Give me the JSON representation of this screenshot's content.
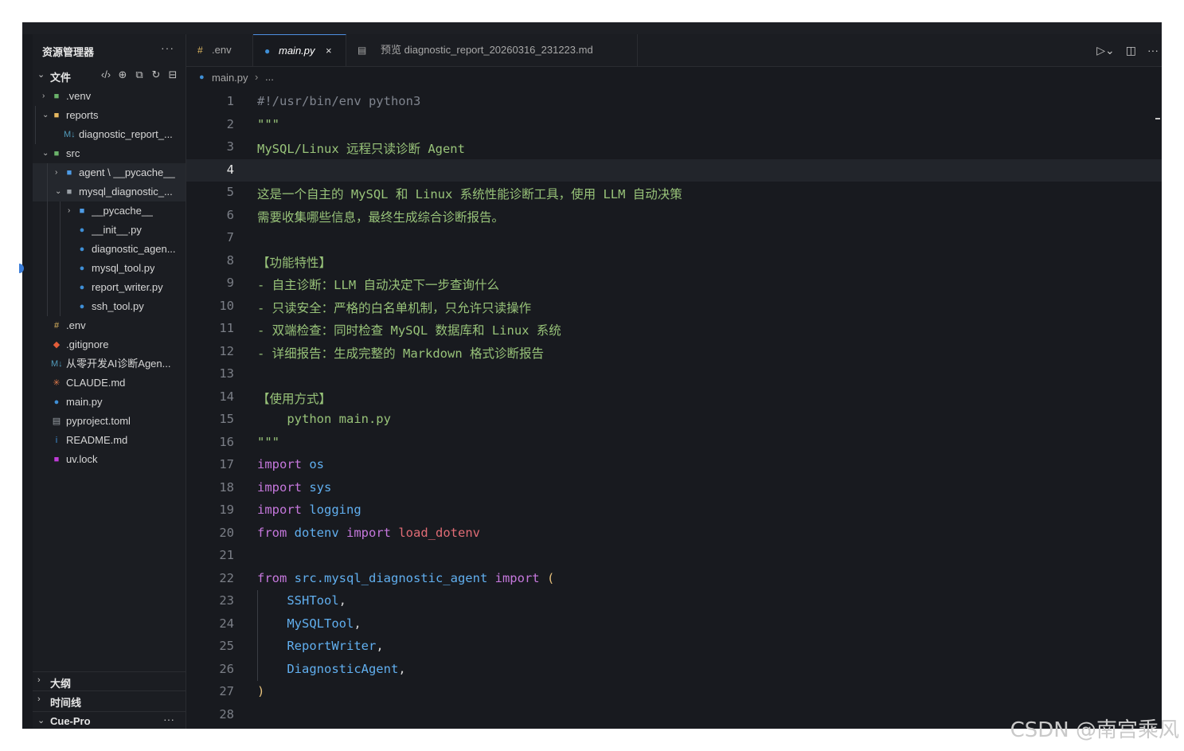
{
  "sidebar": {
    "title": "资源管理器",
    "more": "···",
    "section_label": "文件",
    "actions": [
      {
        "name": "code-icon",
        "glyph": "‹/›"
      },
      {
        "name": "new-file-icon",
        "glyph": "⊕"
      },
      {
        "name": "new-folder-icon",
        "glyph": "⧉"
      },
      {
        "name": "refresh-icon",
        "glyph": "↻"
      },
      {
        "name": "collapse-all-icon",
        "glyph": "⊟"
      }
    ],
    "tree": [
      {
        "name": ".venv",
        "depth": 0,
        "chev": "›",
        "icon": "folder-venv-icon",
        "glyph": "■",
        "color": "#6bb36b"
      },
      {
        "name": "reports",
        "depth": 0,
        "chev": "⌄",
        "icon": "folder-open-icon",
        "glyph": "■",
        "color": "#e7b860"
      },
      {
        "name": "diagnostic_report_...",
        "depth": 1,
        "chev": "",
        "icon": "markdown-icon",
        "glyph": "M↓",
        "color": "#519aba"
      },
      {
        "name": "src",
        "depth": 0,
        "chev": "⌄",
        "icon": "folder-src-icon",
        "glyph": "■",
        "color": "#6bb36b"
      },
      {
        "name": "agent \\ __pycache__",
        "depth": 1,
        "chev": "›",
        "icon": "folder-icon",
        "glyph": "■",
        "color": "#4e9ce6",
        "selected": true
      },
      {
        "name": "mysql_diagnostic_...",
        "depth": 1,
        "chev": "⌄",
        "icon": "folder-open-icon",
        "glyph": "■",
        "color": "#9aa0a6",
        "selected": true
      },
      {
        "name": "__pycache__",
        "depth": 2,
        "chev": "›",
        "icon": "folder-icon",
        "glyph": "■",
        "color": "#4e9ce6"
      },
      {
        "name": "__init__.py",
        "depth": 2,
        "chev": "",
        "icon": "python-icon",
        "glyph": "●",
        "color": "#3f8fd6"
      },
      {
        "name": "diagnostic_agen...",
        "depth": 2,
        "chev": "",
        "icon": "python-icon",
        "glyph": "●",
        "color": "#3f8fd6"
      },
      {
        "name": "mysql_tool.py",
        "depth": 2,
        "chev": "",
        "icon": "python-icon",
        "glyph": "●",
        "color": "#3f8fd6"
      },
      {
        "name": "report_writer.py",
        "depth": 2,
        "chev": "",
        "icon": "python-icon",
        "glyph": "●",
        "color": "#3f8fd6"
      },
      {
        "name": "ssh_tool.py",
        "depth": 2,
        "chev": "",
        "icon": "python-icon",
        "glyph": "●",
        "color": "#3f8fd6"
      },
      {
        "name": ".env",
        "depth": 0,
        "chev": "",
        "icon": "env-icon",
        "glyph": "#",
        "color": "#e0b860"
      },
      {
        "name": ".gitignore",
        "depth": 0,
        "chev": "",
        "icon": "git-icon",
        "glyph": "◆",
        "color": "#e35d3a"
      },
      {
        "name": "从零开发AI诊断Agen...",
        "depth": 0,
        "chev": "",
        "icon": "markdown-icon",
        "glyph": "M↓",
        "color": "#519aba"
      },
      {
        "name": "CLAUDE.md",
        "depth": 0,
        "chev": "",
        "icon": "claude-icon",
        "glyph": "✳",
        "color": "#e07a4b"
      },
      {
        "name": "main.py",
        "depth": 0,
        "chev": "",
        "icon": "python-icon",
        "glyph": "●",
        "color": "#3f8fd6"
      },
      {
        "name": "pyproject.toml",
        "depth": 0,
        "chev": "",
        "icon": "toml-icon",
        "glyph": "▤",
        "color": "#9aa0a6"
      },
      {
        "name": "README.md",
        "depth": 0,
        "chev": "",
        "icon": "info-icon",
        "glyph": "i",
        "color": "#3f8fd6"
      },
      {
        "name": "uv.lock",
        "depth": 0,
        "chev": "",
        "icon": "lock-icon",
        "glyph": "■",
        "color": "#c03cd8"
      }
    ],
    "bottom": [
      {
        "label": "大纲",
        "chev": "›"
      },
      {
        "label": "时间线",
        "chev": "›"
      },
      {
        "label": "Cue-Pro",
        "chev": "⌄",
        "more": "···"
      }
    ]
  },
  "tabs": [
    {
      "label": ".env",
      "icon": "env-icon",
      "glyph": "#",
      "color": "#e0b860",
      "active": false
    },
    {
      "label": "main.py",
      "icon": "python-icon",
      "glyph": "●",
      "color": "#3f8fd6",
      "active": true,
      "close": "×"
    },
    {
      "label": "预览 diagnostic_report_20260316_231223.md",
      "icon": "preview-icon",
      "glyph": "▤",
      "color": "#a8a8a8",
      "active": false
    }
  ],
  "toolbar_right": [
    {
      "name": "run-icon",
      "glyph": "▷⌄"
    },
    {
      "name": "split-editor-icon",
      "glyph": "◫"
    },
    {
      "name": "more-actions-icon",
      "glyph": "···"
    }
  ],
  "breadcrumb": {
    "file": "main.py",
    "sep": "›",
    "rest": "..."
  },
  "editor": {
    "current_line": 4,
    "lines": [
      [
        [
          "c-cmt",
          "#!/usr/bin/env python3"
        ]
      ],
      [
        [
          "c-str",
          "\"\"\""
        ]
      ],
      [
        [
          "c-str",
          "MySQL/Linux 远程只读诊断 Agent"
        ]
      ],
      [],
      [
        [
          "c-str",
          "这是一个自主的 MySQL 和 Linux 系统性能诊断工具，使用 LLM 自动决策"
        ]
      ],
      [
        [
          "c-str",
          "需要收集哪些信息，最终生成综合诊断报告。"
        ]
      ],
      [],
      [
        [
          "c-str",
          "【功能特性】"
        ]
      ],
      [
        [
          "c-str",
          "- 自主诊断：LLM 自动决定下一步查询什么"
        ]
      ],
      [
        [
          "c-str",
          "- 只读安全：严格的白名单机制，只允许只读操作"
        ]
      ],
      [
        [
          "c-str",
          "- 双端检查：同时检查 MySQL 数据库和 Linux 系统"
        ]
      ],
      [
        [
          "c-str",
          "- 详细报告：生成完整的 Markdown 格式诊断报告"
        ]
      ],
      [],
      [
        [
          "c-str",
          "【使用方式】"
        ]
      ],
      [
        [
          "c-str",
          "    python main.py"
        ]
      ],
      [
        [
          "c-str",
          "\"\"\""
        ]
      ],
      [
        [
          "c-kw",
          "import "
        ],
        [
          "c-mod",
          "os"
        ]
      ],
      [
        [
          "c-kw",
          "import "
        ],
        [
          "c-mod",
          "sys"
        ]
      ],
      [
        [
          "c-kw",
          "import "
        ],
        [
          "c-mod",
          "logging"
        ]
      ],
      [
        [
          "c-kw",
          "from "
        ],
        [
          "c-mod",
          "dotenv "
        ],
        [
          "c-kw",
          "import "
        ],
        [
          "c-var",
          "load_dotenv"
        ]
      ],
      [],
      [
        [
          "c-kw",
          "from "
        ],
        [
          "c-mod",
          "src.mysql_diagnostic_agent "
        ],
        [
          "c-kw",
          "import "
        ],
        [
          "c-par",
          "("
        ]
      ],
      [
        [
          "c-mod",
          "    SSHTool"
        ],
        [
          "c-pun",
          ","
        ]
      ],
      [
        [
          "c-mod",
          "    MySQLTool"
        ],
        [
          "c-pun",
          ","
        ]
      ],
      [
        [
          "c-mod",
          "    ReportWriter"
        ],
        [
          "c-pun",
          ","
        ]
      ],
      [
        [
          "c-mod",
          "    DiagnosticAgent"
        ],
        [
          "c-pun",
          ","
        ]
      ],
      [
        [
          "c-par",
          ")"
        ]
      ],
      []
    ]
  },
  "watermark": "CSDN @南宫乘风"
}
